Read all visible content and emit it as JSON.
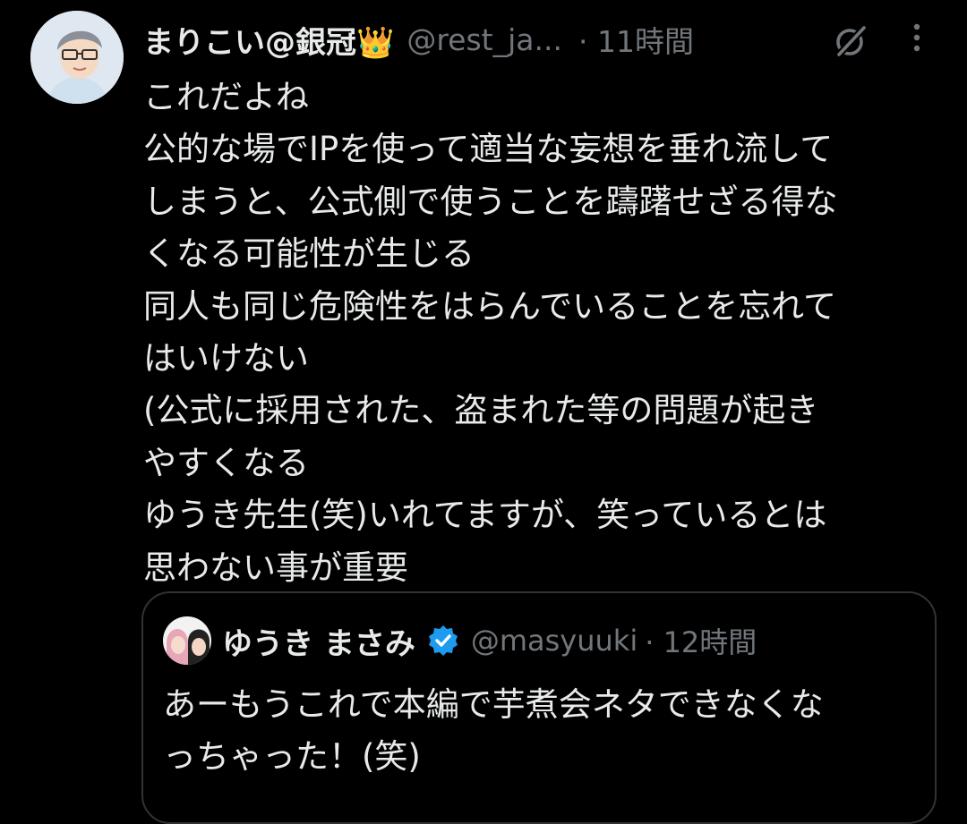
{
  "tweet": {
    "display_name": "まりこい@銀冠👑",
    "handle": "@rest_ja...",
    "time": "· 11時間",
    "icons": {
      "grok": "grok-icon",
      "more": "more-dots-icon"
    },
    "lines": [
      "これだよね",
      "公的な場でIPを使って適当な妄想を垂れ流して",
      "しまうと、公式側で使うことを躊躇せざる得な",
      "くなる可能性が生じる",
      "同人も同じ危険性をはらんでいることを忘れて",
      "はいけない",
      "(公式に採用された、盗まれた等の問題が起き",
      "やすくなる",
      "ゆうき先生(笑)いれてますが、笑っているとは",
      "思わない事が重要"
    ]
  },
  "quote": {
    "display_name": "ゆうき まさみ",
    "handle": "@masyuuki",
    "time": "· 12時間",
    "lines": [
      "あーもうこれで本編で芋煮会ネタできなくな",
      "っちゃった！(笑)"
    ]
  },
  "colors": {
    "background": "#000000",
    "text_primary": "#e7e9ea",
    "text_secondary": "#71767b",
    "border": "#2f3336",
    "verified": "#1d9bf0"
  }
}
